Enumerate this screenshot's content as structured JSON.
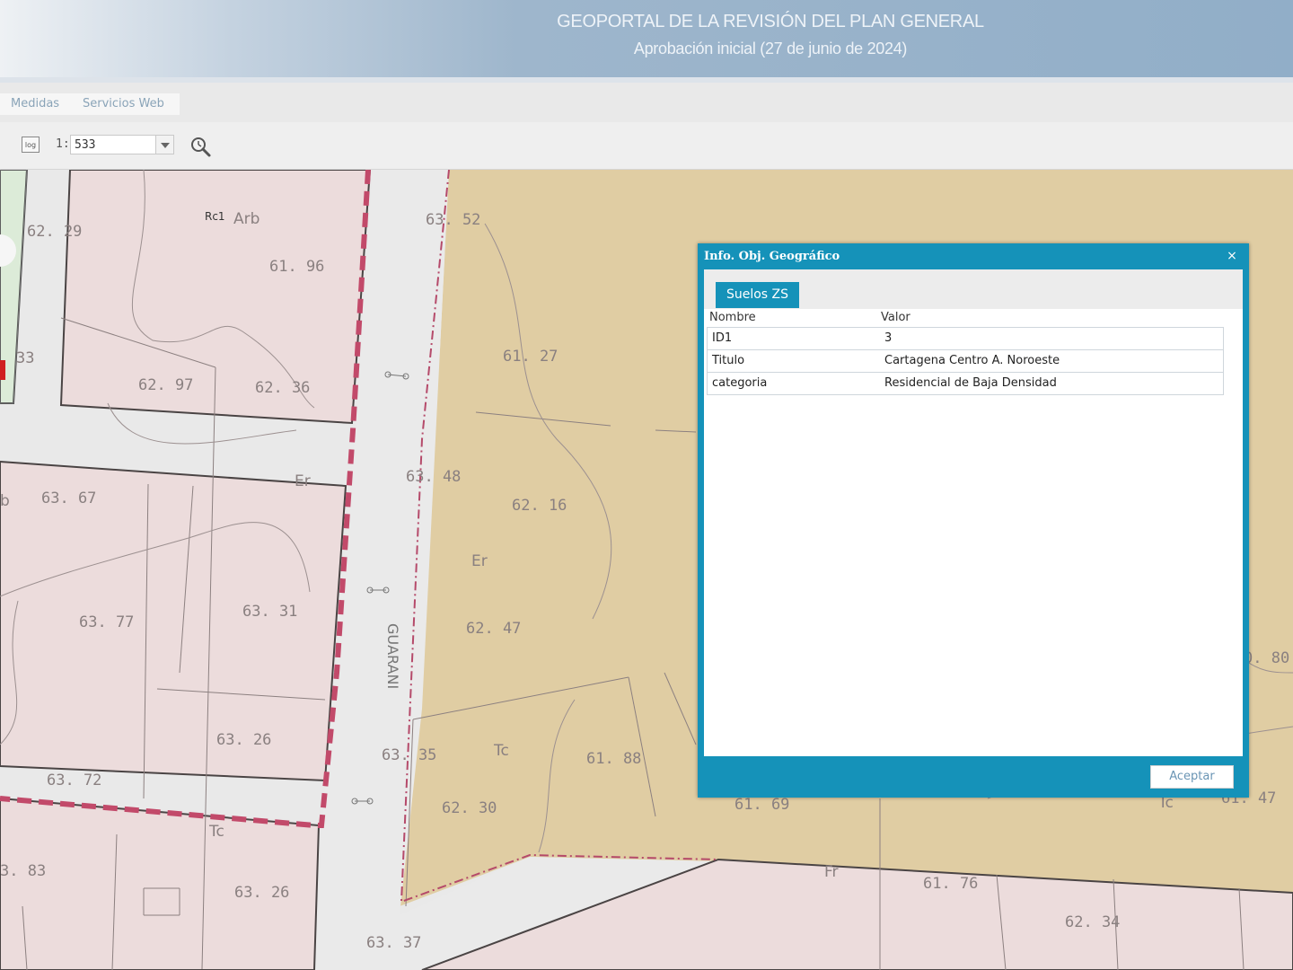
{
  "header": {
    "title": "GEOPORTAL DE LA REVISIÓN DEL PLAN GENERAL",
    "subtitle": "Aprobación inicial (27 de junio de 2024)"
  },
  "tabs": [
    {
      "label": "Medidas"
    },
    {
      "label": "Servicios Web"
    }
  ],
  "scale": {
    "log_label": "log",
    "prefix": "1:",
    "value": "533"
  },
  "map": {
    "street_name": "GUARANI",
    "elevation_labels": [
      "62. 29",
      "61. 96",
      "62. 97",
      "62. 36",
      "63. 67",
      "63. 77",
      "63. 31",
      "63. 26",
      "63. 72",
      "3. 83",
      "63. 26",
      "63. 37",
      "63. 35",
      "62. 30",
      "63. 48",
      "63. 52",
      "61. 27",
      "62. 16",
      "62. 47",
      "61. 88",
      "61. 69",
      "61. 76",
      "62. 34",
      "0. 80",
      "61. 47",
      "33"
    ],
    "feature_labels": [
      "Rc1",
      "Arb",
      "Er",
      "Er",
      "Tc",
      "Tc",
      "Tc",
      "Fr",
      "b"
    ],
    "colors": {
      "parcel_pink": "#ecdcdc",
      "zone_tan": "#e0cda3",
      "road": "#eaeaea",
      "boundary_red": "#c24a6a",
      "green_area": "#dcebd8"
    }
  },
  "dialog": {
    "title": "Info. Obj. Geográfico",
    "close_symbol": "×",
    "tab_label": "Suelos ZS",
    "columns": {
      "name": "Nombre",
      "value": "Valor"
    },
    "rows": [
      {
        "name": "ID1",
        "value": "3"
      },
      {
        "name": "Titulo",
        "value": "Cartagena Centro A. Noroeste"
      },
      {
        "name": "categoria",
        "value": "Residencial de Baja Densidad"
      }
    ],
    "accept_label": "Aceptar"
  }
}
